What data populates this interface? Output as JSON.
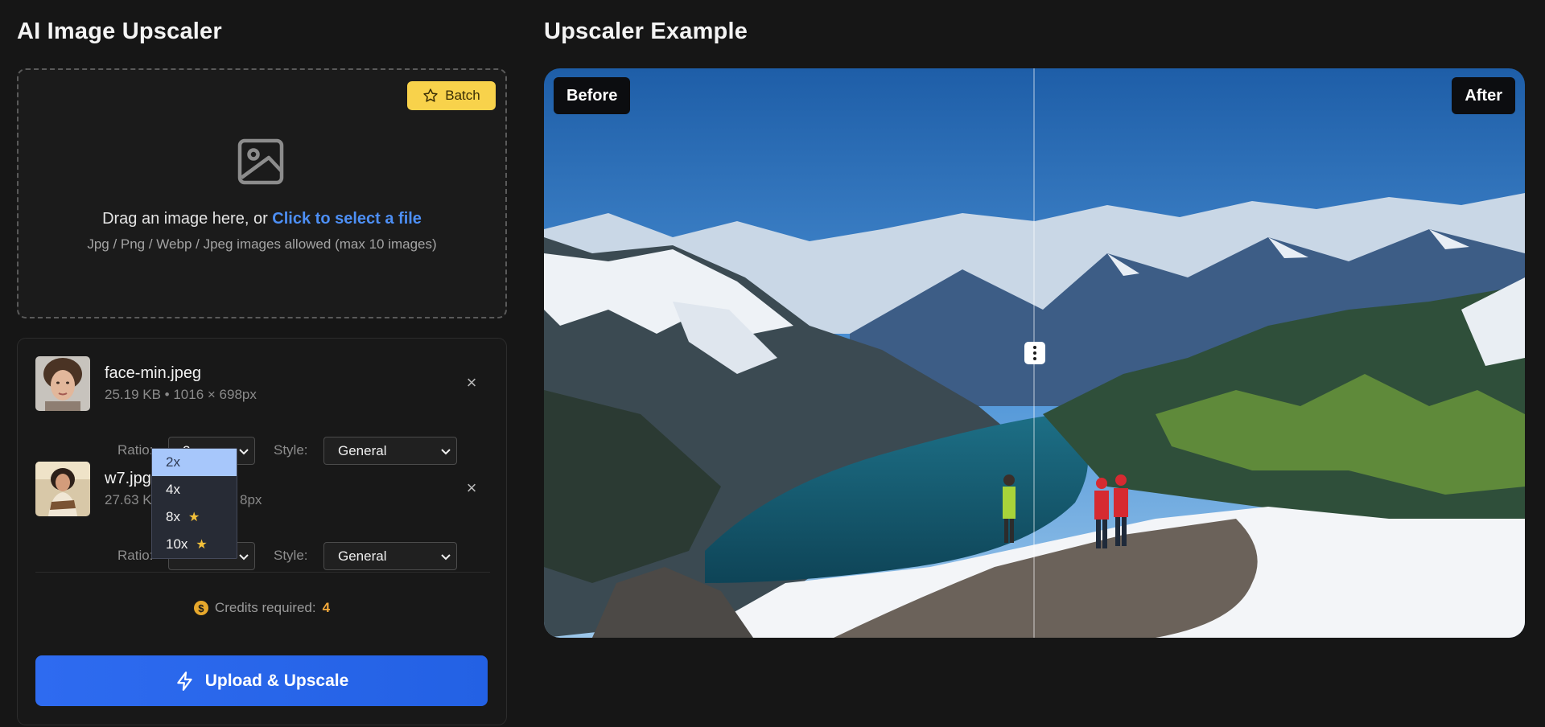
{
  "left": {
    "title": "AI Image Upscaler",
    "batch_label": "Batch",
    "drop_text": "Drag an image here, or ",
    "drop_link": "Click to select a file",
    "drop_hint": "Jpg / Png / Webp / Jpeg images allowed (max 10 images)"
  },
  "files": [
    {
      "name": "face-min.jpeg",
      "meta": "25.19 KB • 1016 × 698px",
      "ratio_label": "Ratio:",
      "ratio_value": "2x",
      "style_label": "Style:",
      "style_value": "General",
      "remove": "×"
    },
    {
      "name": "w7.jpg",
      "meta_left": "27.63 K",
      "meta_right": "8px",
      "ratio_label": "Ratio:",
      "style_label": "Style:",
      "style_value": "General",
      "remove": "×"
    }
  ],
  "ratio_dropdown": {
    "options": [
      {
        "label": "2x",
        "selected": true,
        "premium": false
      },
      {
        "label": "4x",
        "selected": false,
        "premium": false
      },
      {
        "label": "8x",
        "selected": false,
        "premium": true
      },
      {
        "label": "10x",
        "selected": false,
        "premium": true
      }
    ]
  },
  "credits": {
    "label": "Credits required:",
    "value": "4",
    "icon": "$"
  },
  "upload_label": "Upload & Upscale",
  "example": {
    "title": "Upscaler Example",
    "before_label": "Before",
    "after_label": "After"
  },
  "colors": {
    "background": "#161616",
    "accent_blue": "#2e6bf0",
    "link_blue": "#4d8ff5",
    "batch_yellow": "#f8d24b",
    "credits_orange": "#f2a93b"
  }
}
